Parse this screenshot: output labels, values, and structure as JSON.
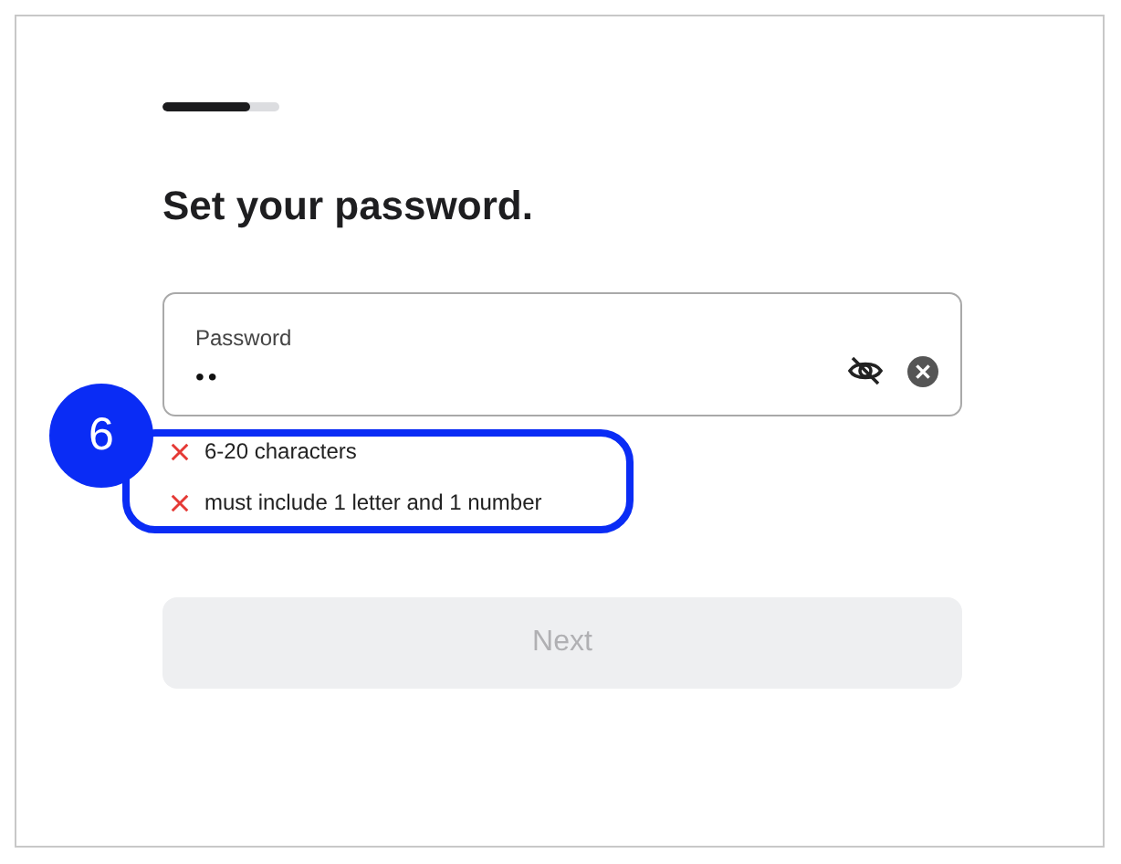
{
  "progress": {
    "level": 0.75
  },
  "title": "Set your password.",
  "password_field": {
    "label": "Password",
    "value": "••",
    "revealed": false
  },
  "rules": [
    {
      "text": "6-20 characters",
      "met": false
    },
    {
      "text": "must include 1 letter and 1 number",
      "met": false
    }
  ],
  "annotation": {
    "number": "6"
  },
  "next_button": {
    "label": "Next",
    "disabled": true
  }
}
